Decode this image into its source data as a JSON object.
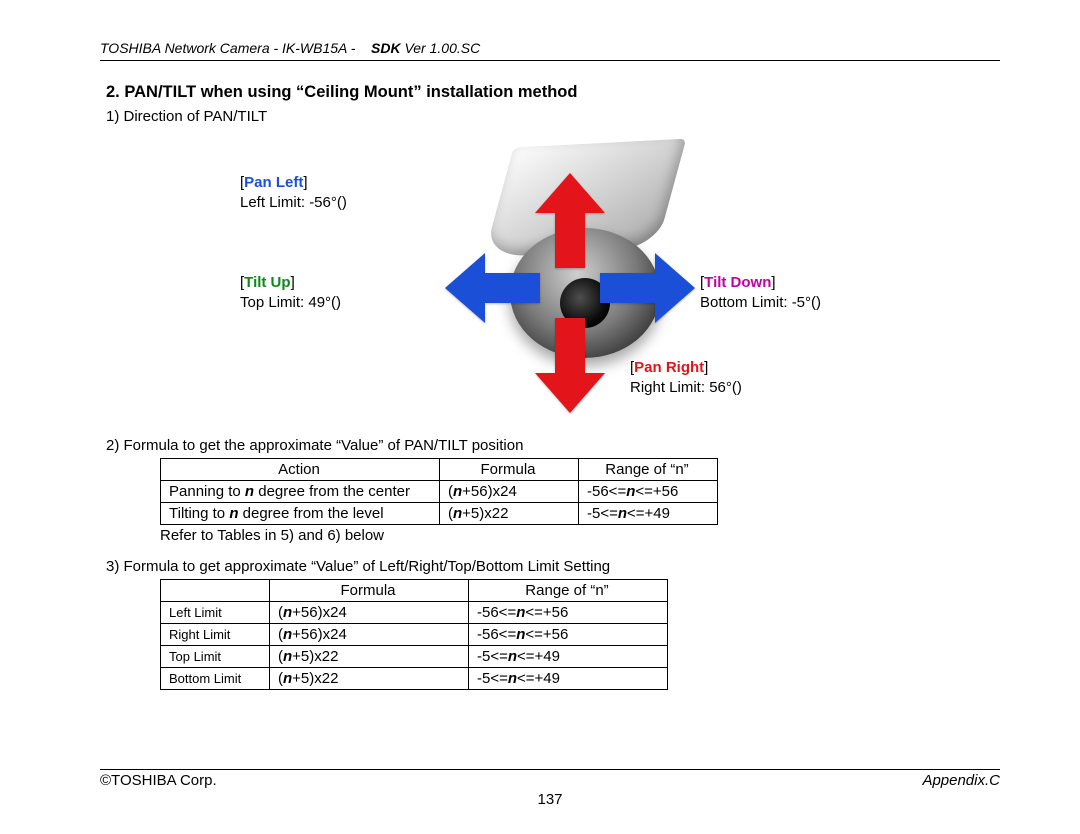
{
  "header": {
    "left": "TOSHIBA Network Camera - IK-WB15A -",
    "sdk": "SDK",
    "ver": "Ver 1.00.SC"
  },
  "section": {
    "number_title": "2.  PAN/TILT when using “Ceiling Mount” installation method",
    "sub1": "1)  Direction of PAN/TILT",
    "sub2": "2)  Formula to get the approximate “Value” of PAN/TILT position",
    "sub3": "3)  Formula to get approximate “Value” of Left/Right/Top/Bottom Limit Setting"
  },
  "labels": {
    "pan_left": "Pan Left",
    "left_limit": "Left Limit: -56°()",
    "tilt_up": "Tilt Up",
    "top_limit": "Top Limit: 49°()",
    "tilt_down": "Tilt Down",
    "bottom_limit": "Bottom Limit: -5°()",
    "pan_right": "Pan Right",
    "right_limit": "Right Limit: 56°()"
  },
  "table2": {
    "head": {
      "action": "Action",
      "formula": "Formula",
      "range": "Range of “n”"
    },
    "rows": [
      {
        "action_pre": "Panning to ",
        "action_var": "n",
        "action_post": " degree from the center",
        "formula_pre": "(",
        "formula_var": "n",
        "formula_post": "+56)x24",
        "range_pre": "-56<=",
        "range_var": "n",
        "range_post": "<=+56"
      },
      {
        "action_pre": "Tilting to ",
        "action_var": "n",
        "action_post": " degree from the level",
        "formula_pre": "(",
        "formula_var": "n",
        "formula_post": "+5)x22",
        "range_pre": "-5<=",
        "range_var": "n",
        "range_post": "<=+49"
      }
    ],
    "note": "Refer to Tables in 5) and 6) below"
  },
  "table3": {
    "head": {
      "blank": "",
      "formula": "Formula",
      "range": "Range of “n”"
    },
    "rows": [
      {
        "name": "Left Limit",
        "formula_pre": "(",
        "formula_var": "n",
        "formula_post": "+56)x24",
        "range_pre": "-56<=",
        "range_var": "n",
        "range_post": "<=+56"
      },
      {
        "name": "Right Limit",
        "formula_pre": "(",
        "formula_var": "n",
        "formula_post": "+56)x24",
        "range_pre": "-56<=",
        "range_var": "n",
        "range_post": "<=+56"
      },
      {
        "name": "Top Limit",
        "formula_pre": "(",
        "formula_var": "n",
        "formula_post": "+5)x22",
        "range_pre": "-5<=",
        "range_var": "n",
        "range_post": "<=+49"
      },
      {
        "name": "Bottom Limit",
        "formula_pre": "(",
        "formula_var": "n",
        "formula_post": "+5)x22",
        "range_pre": "-5<=",
        "range_var": "n",
        "range_post": "<=+49"
      }
    ]
  },
  "footer": {
    "left": "©TOSHIBA Corp.",
    "right": "Appendix.C",
    "page": "137"
  }
}
